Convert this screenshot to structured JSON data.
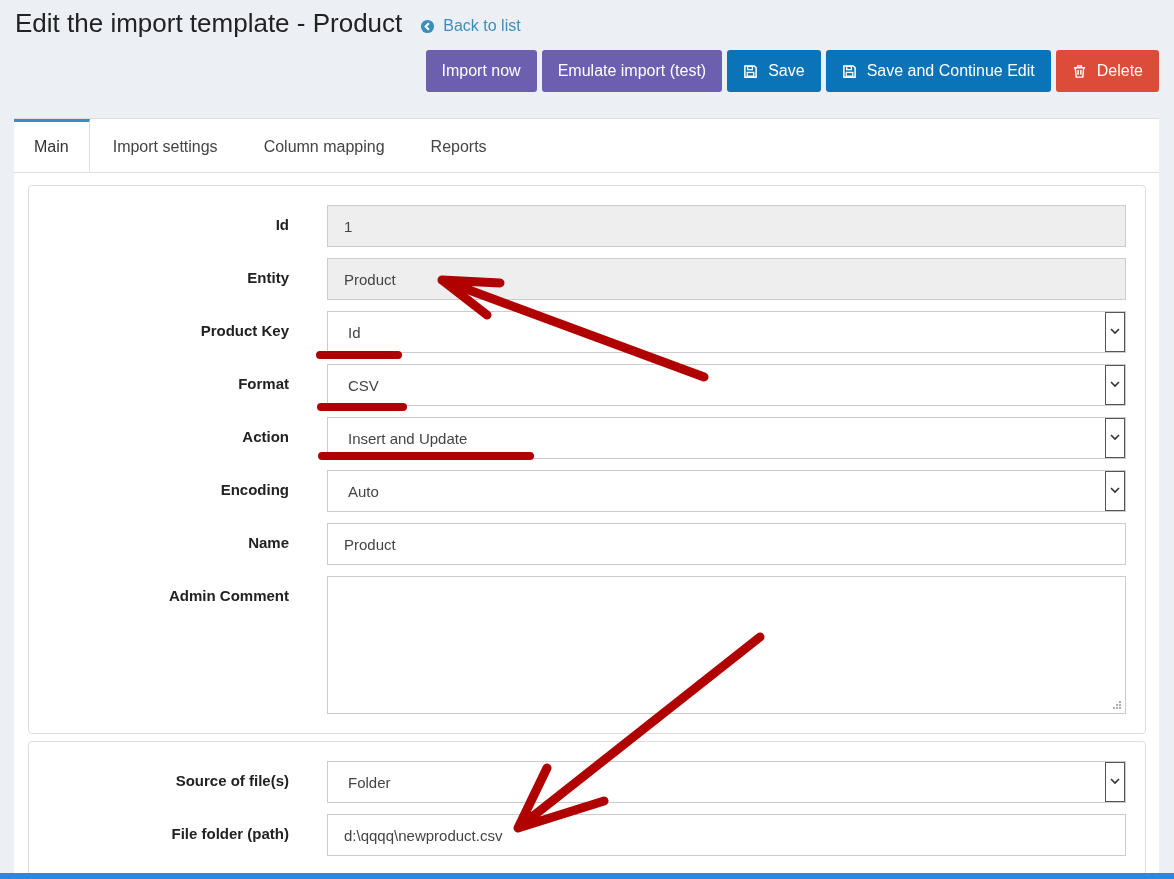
{
  "page": {
    "title": "Edit the import template - Product",
    "back_link": "Back to list"
  },
  "buttons": [
    {
      "label": "Import now",
      "kind": "import"
    },
    {
      "label": "Emulate import (test)",
      "kind": "import"
    },
    {
      "label": "Save",
      "kind": "save"
    },
    {
      "label": "Save and Continue Edit",
      "kind": "save"
    },
    {
      "label": "Delete",
      "kind": "delete"
    }
  ],
  "tabs": [
    {
      "label": "Main",
      "selected": true
    },
    {
      "label": "Import settings",
      "selected": false
    },
    {
      "label": "Column mapping",
      "selected": false
    },
    {
      "label": "Reports",
      "selected": false
    }
  ],
  "sections": [
    {
      "fields": [
        {
          "label": "Id",
          "kind": "readonly",
          "value": "1"
        },
        {
          "label": "Entity",
          "kind": "readonly",
          "value": "Product"
        },
        {
          "label": "Product Key",
          "kind": "select",
          "value": "Id"
        },
        {
          "label": "Format",
          "kind": "select",
          "value": "CSV"
        },
        {
          "label": "Action",
          "kind": "select",
          "value": "Insert and Update"
        },
        {
          "label": "Encoding",
          "kind": "select",
          "value": "Auto"
        },
        {
          "label": "Name",
          "kind": "text",
          "value": "Product"
        },
        {
          "label": "Admin Comment",
          "kind": "textarea"
        }
      ]
    },
    {
      "fields": [
        {
          "label": "Source of file(s)",
          "kind": "select",
          "value": "Folder"
        },
        {
          "label": "File folder (path)",
          "kind": "text",
          "value": "d:\\qqqq\\newproduct.csv"
        }
      ]
    }
  ]
}
